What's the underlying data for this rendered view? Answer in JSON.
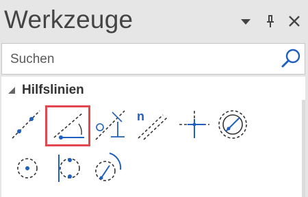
{
  "titlebar": {
    "title": "Werkzeuge",
    "icons": [
      "dropdown-icon",
      "pin-icon",
      "close-icon"
    ]
  },
  "search": {
    "placeholder": "Suchen",
    "value": "",
    "icon": "search-icon"
  },
  "section": {
    "title": "Hilfslinien",
    "expanded": true
  },
  "tools": [
    {
      "icon": "line-through-two-points-icon"
    },
    {
      "icon": "line-at-angle-icon",
      "selected": true
    },
    {
      "icon": "perpendicular-line-icon"
    },
    {
      "icon": "parallel-line-icon",
      "badge": "n"
    },
    {
      "icon": "crosshair-point-icon"
    },
    {
      "icon": "circle-with-diameter-icon"
    },
    {
      "icon": "circle-center-icon"
    },
    {
      "icon": "circle-tangent-line-icon"
    },
    {
      "icon": "circle-tangent-arc-icon"
    }
  ],
  "colors": {
    "accent": "#1f5fbf",
    "selection_border": "#e2474f",
    "panel_bg": "#ffffff",
    "titlebar_bg": "#e6e6e6"
  }
}
